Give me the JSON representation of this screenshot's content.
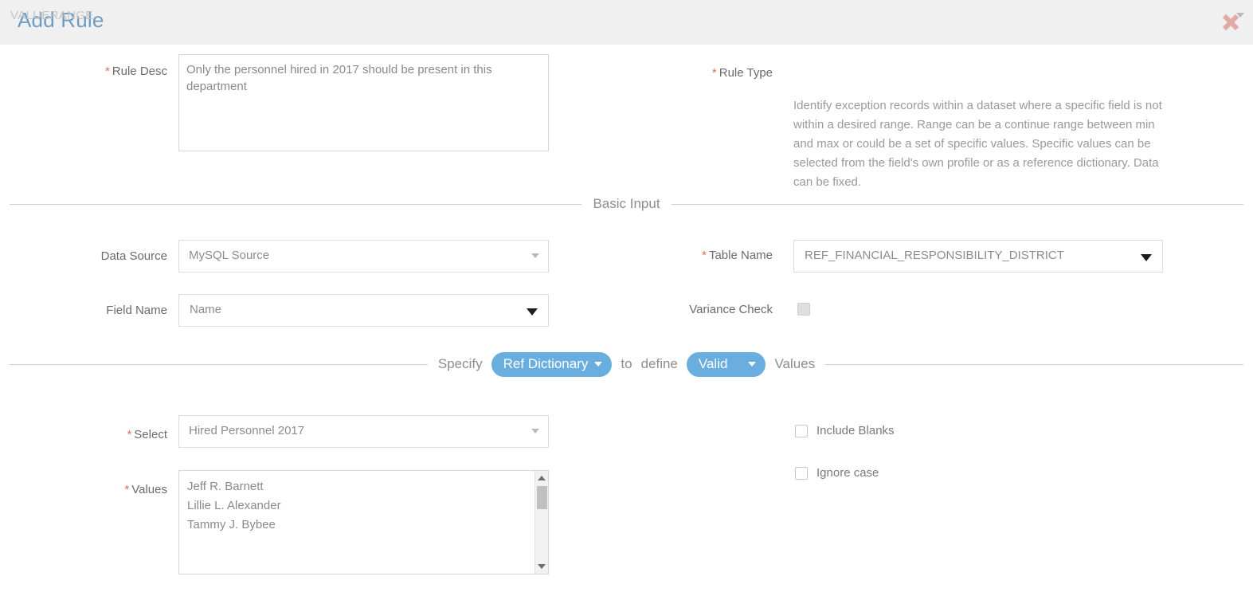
{
  "header": {
    "title": "Add Rule",
    "close_icon": "close-icon"
  },
  "rule_desc": {
    "label": "Rule Desc",
    "required_marker": "*",
    "value": "Only the personnel hired in 2017 should be present in this department"
  },
  "rule_type": {
    "label": "Rule Type",
    "required_marker": "*",
    "value": "VALUERANGE",
    "caret_icon": "chevron-down-icon",
    "description": "Identify exception records within a dataset where a specific field is not within a desired range. Range can be a continue range between min and max or could be a set of specific values. Specific values can be selected from the field's own profile or as a reference dictionary. Data can be fixed."
  },
  "sections": {
    "basic_input": "Basic Input"
  },
  "data_source": {
    "label": "Data Source",
    "value": "MySQL Source",
    "caret_icon": "chevron-down-icon"
  },
  "table_name": {
    "label": "Table Name",
    "required_marker": "*",
    "value": "REF_FINANCIAL_RESPONSIBILITY_DISTRICT",
    "caret_icon": "chevron-down-icon"
  },
  "field_name": {
    "label": "Field Name",
    "value": "Name",
    "caret_icon": "chevron-down-icon"
  },
  "variance_check": {
    "label": "Variance Check",
    "checked": false,
    "disabled": true
  },
  "specify_row": {
    "word_specify": "Specify",
    "source_pill": "Ref Dictionary",
    "word_to": "to",
    "word_define": "define",
    "validity_pill": "Valid",
    "word_values": "Values",
    "pill_caret_icon": "chevron-down-icon",
    "pill_color": "#6aaee0"
  },
  "select_dict": {
    "label": "Select",
    "required_marker": "*",
    "value": "Hired Personnel 2017",
    "caret_icon": "chevron-down-icon"
  },
  "values": {
    "label": "Values",
    "required_marker": "*",
    "items": [
      "Jeff R. Barnett",
      "Lillie L. Alexander",
      "Tammy J. Bybee"
    ],
    "scrollbar": {
      "up_icon": "arrow-up-icon",
      "down_icon": "arrow-down-icon"
    }
  },
  "include_blanks": {
    "label": "Include Blanks",
    "checked": false
  },
  "ignore_case": {
    "label": "Ignore case",
    "checked": false
  },
  "colors": {
    "title": "#6d9cc4",
    "accent": "#6aaee0",
    "required": "#f0685b",
    "close": "#e3aaa5",
    "header_bg": "#f0f0f0"
  }
}
